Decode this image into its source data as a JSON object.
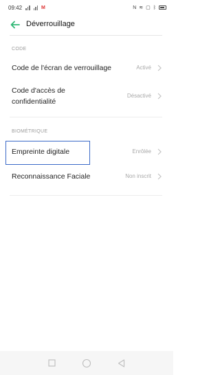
{
  "status_bar": {
    "time": "09:42",
    "carrier_mark": "M",
    "right_icons": [
      "nfc-icon",
      "vibrate-icon",
      "vpn-icon",
      "bluetooth-icon",
      "battery-icon"
    ]
  },
  "header": {
    "title": "Déverrouillage"
  },
  "sections": {
    "code": {
      "label": "CODE",
      "items": [
        {
          "label": "Code de l'écran de verrouillage",
          "value": "Activé"
        },
        {
          "label_line1": "Code d'accès de",
          "label_line2": "confidentialité",
          "value": "Désactivé"
        }
      ]
    },
    "biometric": {
      "label": "BIOMÉTRIQUE",
      "items": [
        {
          "label": "Empreinte digitale",
          "value": "Enrôlée"
        },
        {
          "label": "Reconnaissance Faciale",
          "value": "Non inscrit"
        }
      ]
    }
  },
  "colors": {
    "accent": "#2fb774",
    "highlight": "#3a69c7",
    "value_text": "#a8a8a8"
  }
}
